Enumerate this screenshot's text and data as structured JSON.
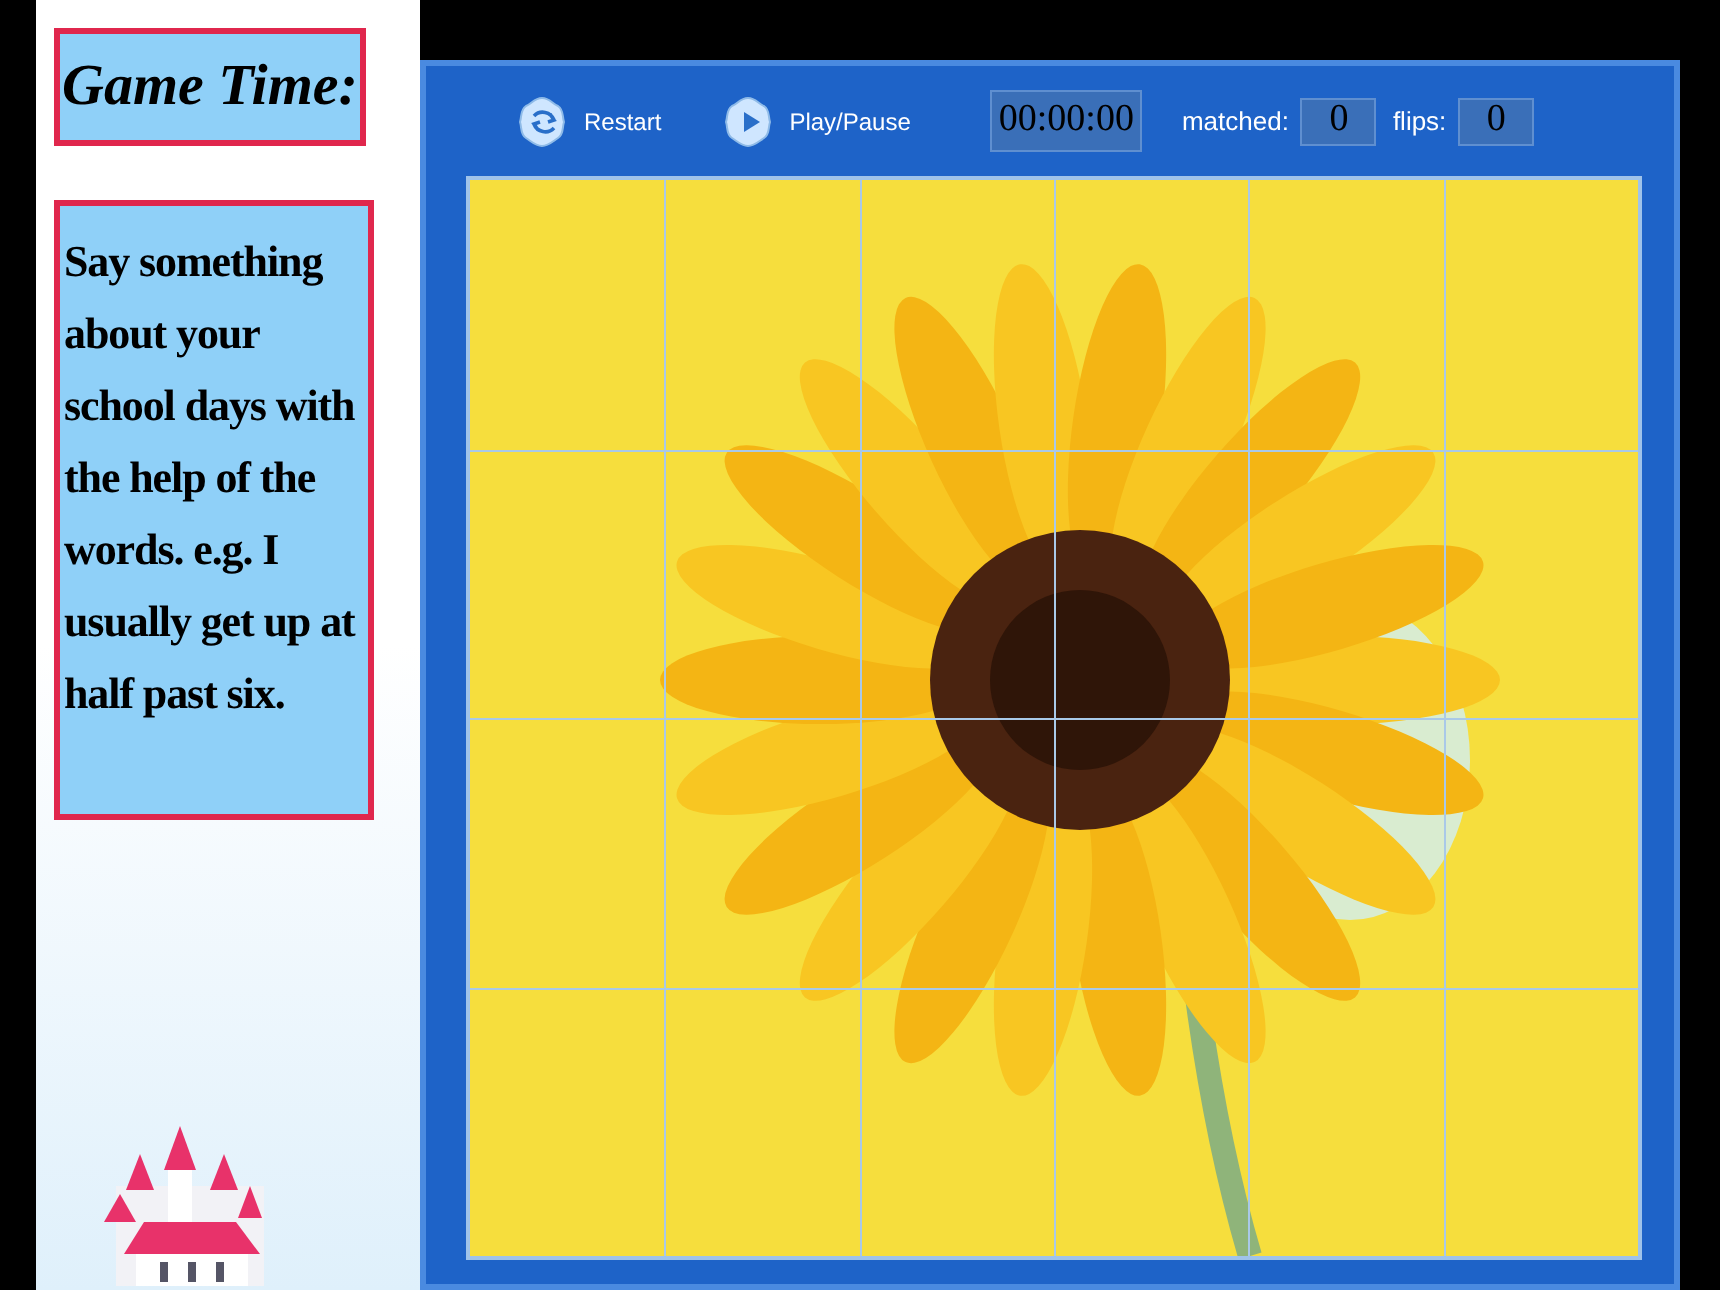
{
  "title": "Game Time:",
  "prompt": "Say something about your school days with the help of the words. e.g. I usually get up at half past six.",
  "game": {
    "buttons": [
      {
        "label": "Restart",
        "kind": "restart"
      },
      {
        "label": "Play/Pause",
        "kind": "play"
      }
    ],
    "timer": "00:00:00",
    "counters": [
      {
        "label": "matched:",
        "value": "0"
      },
      {
        "label": "flips:",
        "value": "0"
      }
    ]
  }
}
